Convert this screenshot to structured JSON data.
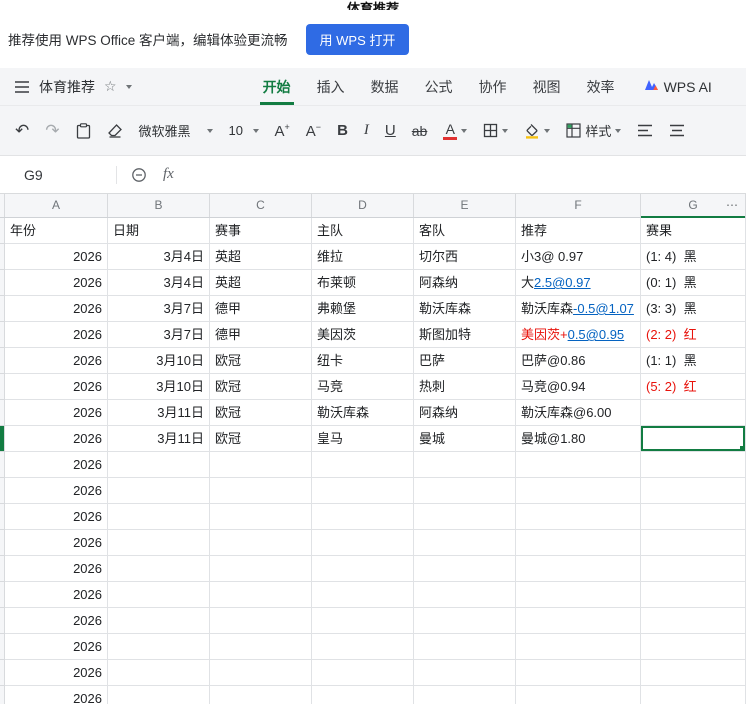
{
  "window": {
    "top_title": "体育推荐"
  },
  "banner": {
    "message": "推荐使用 WPS Office 客户端，编辑体验更流畅",
    "open_button": "用 WPS 打开"
  },
  "menubar": {
    "doc_title": "体育推荐",
    "tabs": [
      "开始",
      "插入",
      "数据",
      "公式",
      "协作",
      "视图",
      "效率"
    ],
    "active_tab": "开始",
    "ai_tab": "WPS AI"
  },
  "toolbar": {
    "font_name": "微软雅黑",
    "font_size": "10",
    "bold": "B",
    "italic": "I",
    "underline": "U",
    "strike": "ab",
    "color_letter": "A",
    "font_bigger": "A",
    "font_smaller": "A",
    "style_label": "样式"
  },
  "formula_bar": {
    "cell_ref": "G9",
    "fx": "fx"
  },
  "grid": {
    "corner_more": "⋯",
    "columns": [
      "A",
      "B",
      "C",
      "D",
      "E",
      "F",
      "G"
    ],
    "selected_column": "G",
    "selected_cell": "G9",
    "headers": [
      "年份",
      "日期",
      "赛事",
      "主队",
      "客队",
      "推荐",
      "赛果"
    ],
    "rows": [
      {
        "year": "2026",
        "date": "3月4日",
        "league": "英超",
        "home": "维拉",
        "away": "切尔西",
        "tip": [
          {
            "text": "小3@ 0.97"
          }
        ],
        "result": "(1: 4)  黑"
      },
      {
        "year": "2026",
        "date": "3月4日",
        "league": "英超",
        "home": "布莱顿",
        "away": "阿森纳",
        "tip": [
          {
            "text": "大"
          },
          {
            "text": "2.5@0.97",
            "style": "link"
          }
        ],
        "result": "(0: 1)  黑"
      },
      {
        "year": "2026",
        "date": "3月7日",
        "league": "德甲",
        "home": "弗赖堡",
        "away": "勒沃库森",
        "tip": [
          {
            "text": "勒沃库森"
          },
          {
            "text": "-0.5@1.07",
            "style": "link"
          }
        ],
        "result": "(3: 3)  黑"
      },
      {
        "year": "2026",
        "date": "3月7日",
        "league": "德甲",
        "home": "美因茨",
        "away": "斯图加特",
        "tip": [
          {
            "text": "美因茨+",
            "style": "red"
          },
          {
            "text": "0.5@0.95",
            "style": "link"
          }
        ],
        "result": "(2: 2)  红",
        "result_style": "red"
      },
      {
        "year": "2026",
        "date": "3月10日",
        "league": "欧冠",
        "home": "纽卡",
        "away": "巴萨",
        "tip": [
          {
            "text": "巴萨@0.86"
          }
        ],
        "result": "(1: 1)  黑"
      },
      {
        "year": "2026",
        "date": "3月10日",
        "league": "欧冠",
        "home": "马竞",
        "away": "热刺",
        "tip": [
          {
            "text": "马竞@0.94"
          }
        ],
        "result": "(5: 2)  红",
        "result_style": "red"
      },
      {
        "year": "2026",
        "date": "3月11日",
        "league": "欧冠",
        "home": "勒沃库森",
        "away": "阿森纳",
        "tip": [
          {
            "text": "勒沃库森@6.00"
          }
        ],
        "result": ""
      },
      {
        "year": "2026",
        "date": "3月11日",
        "league": "欧冠",
        "home": "皇马",
        "away": "曼城",
        "tip": [
          {
            "text": "曼城@1.80"
          }
        ],
        "result": "",
        "selected": true
      },
      {
        "year": "2026"
      },
      {
        "year": "2026"
      },
      {
        "year": "2026"
      },
      {
        "year": "2026"
      },
      {
        "year": "2026"
      },
      {
        "year": "2026"
      },
      {
        "year": "2026"
      },
      {
        "year": "2026"
      },
      {
        "year": "2026"
      },
      {
        "year": "2026"
      }
    ]
  },
  "colors": {
    "wps_green": "#127c42",
    "link_blue": "#0563c1",
    "alert_red": "#e8130c",
    "open_button_blue": "#2f6be4"
  }
}
